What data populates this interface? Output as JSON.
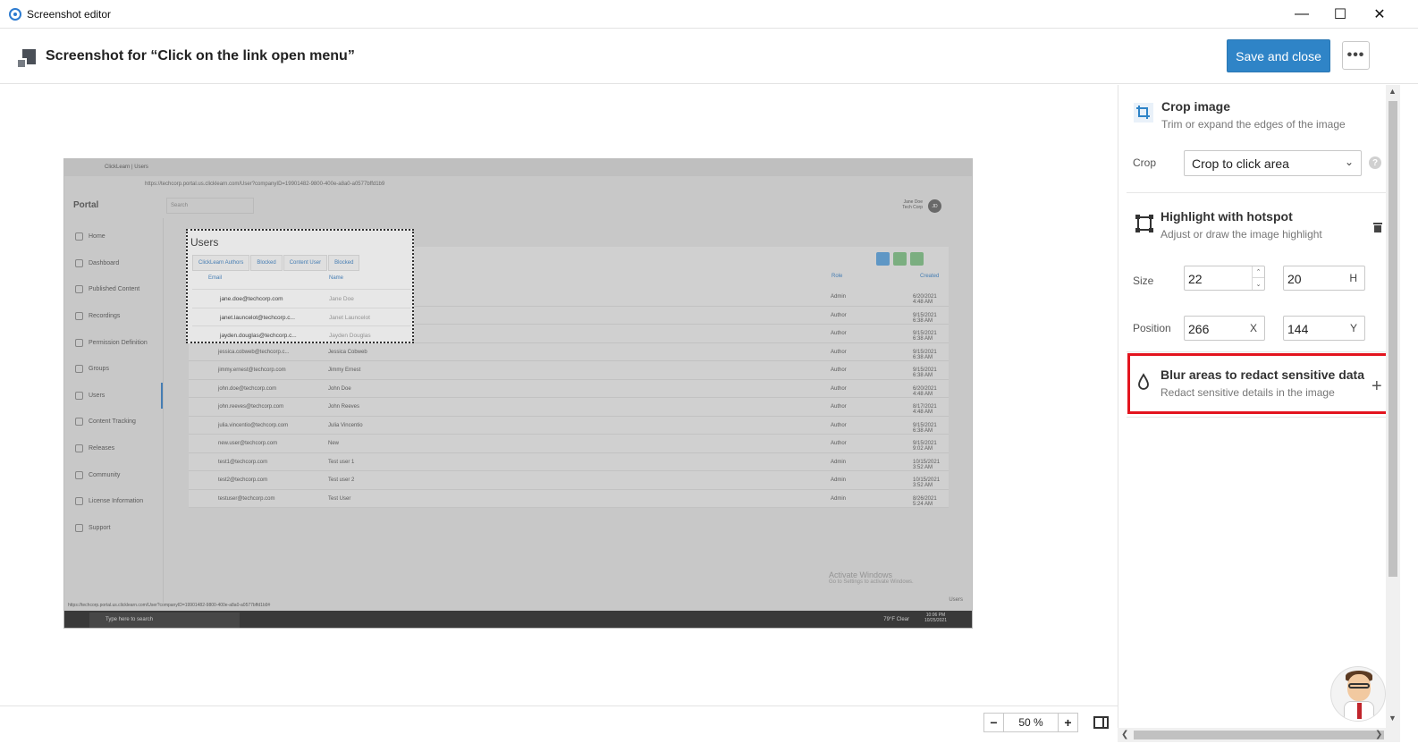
{
  "window": {
    "title": "Screenshot editor",
    "minimize": "—",
    "maximize": "☐",
    "close": "✕"
  },
  "header": {
    "title": "Screenshot for “Click on the link open menu”",
    "save_label": "Save and close",
    "more_label": "•••"
  },
  "screenshot": {
    "tab_title": "ClickLearn | Users",
    "url": "https://techcorp.portal.us.clicklearn.com/User?companyID=19901482-9800-400e-a8a0-a0577bffd1b9",
    "portal_title": "Portal",
    "search_placeholder": "Search",
    "user_name": "Jane Doe",
    "user_company": "Tech Corp",
    "avatar_initials": "JD",
    "nav": [
      "Home",
      "Dashboard",
      "Published Content",
      "Recordings",
      "Permission Definition",
      "Groups",
      "Users",
      "Content Tracking",
      "Releases",
      "Community",
      "License Information",
      "Support"
    ],
    "columns": {
      "email": "Email",
      "name": "Name",
      "role": "Role",
      "created": "Created"
    },
    "rows": [
      {
        "email": "jane.doe@techcorp.com",
        "name": "Jane Doe",
        "role": "Admin",
        "created": "6/20/2021 4:48 AM"
      },
      {
        "email": "janet.launcelot@techcorp.c...",
        "name": "Janet Launcelot",
        "role": "Author",
        "created": "9/15/2021 6:38 AM"
      },
      {
        "email": "jayden.douglas@techcorp.c...",
        "name": "Jayden Douglas",
        "role": "Author",
        "created": "9/15/2021 6:38 AM"
      },
      {
        "email": "jessica.cobweb@techcorp.c...",
        "name": "Jessica Cobweb",
        "role": "Author",
        "created": "9/15/2021 6:38 AM"
      },
      {
        "email": "jimmy.ernest@techcorp.com",
        "name": "Jimmy Ernest",
        "role": "Author",
        "created": "9/15/2021 6:38 AM"
      },
      {
        "email": "john.doe@techcorp.com",
        "name": "John Doe",
        "role": "Author",
        "created": "6/20/2021 4:48 AM"
      },
      {
        "email": "john.reeves@techcorp.com",
        "name": "John Reeves",
        "role": "Author",
        "created": "8/17/2021 4:48 AM"
      },
      {
        "email": "julia.vincentio@techcorp.com",
        "name": "Julia Vincentio",
        "role": "Author",
        "created": "9/15/2021 6:38 AM"
      },
      {
        "email": "new.user@techcorp.com",
        "name": "New",
        "role": "Author",
        "created": "9/15/2021 9:02 AM"
      },
      {
        "email": "test1@techcorp.com",
        "name": "Test user 1",
        "role": "Admin",
        "created": "10/15/2021 3:52 AM"
      },
      {
        "email": "test2@techcorp.com",
        "name": "Test user 2",
        "role": "Admin",
        "created": "10/15/2021 3:52 AM"
      },
      {
        "email": "testuser@techcorp.com",
        "name": "Test User",
        "role": "Admin",
        "created": "8/26/2021 5:24 AM"
      }
    ],
    "popup": {
      "title": "Users",
      "tabs": [
        "ClickLearn Authors",
        "Blocked",
        "Content User",
        "Blocked"
      ]
    },
    "watermark_title": "Activate Windows",
    "watermark_sub": "Go to Settings to activate Windows.",
    "status_url": "https://techcorp.portal.us.clicklearn.com/User?companyID=19901482-9800-400e-a8a0-a0577bffd1b9#",
    "users_label": "Users",
    "taskbar_search": "Type here to search",
    "weather": "79°F  Clear",
    "time": "10:06 PM",
    "date": "10/25/2021"
  },
  "panel": {
    "crop": {
      "title": "Crop image",
      "subtitle": "Trim or expand the edges of the image",
      "label": "Crop",
      "value": "Crop to click area",
      "help": "?"
    },
    "hotspot": {
      "title": "Highlight with hotspot",
      "subtitle": "Adjust or draw the image highlight",
      "size_label": "Size",
      "size_w": "22",
      "size_h": "20",
      "size_h_suffix": "H",
      "position_label": "Position",
      "pos_x": "266",
      "pos_x_suffix": "X",
      "pos_y": "144",
      "pos_y_suffix": "Y"
    },
    "blur": {
      "title": "Blur areas to redact sensitive data",
      "subtitle": "Redact sensitive details in the image",
      "add": "+"
    }
  },
  "footer": {
    "zoom_out": "−",
    "zoom_value": "50 %",
    "zoom_in": "+"
  },
  "colors": {
    "accent": "#2f84c7",
    "highlight": "#e3141e"
  }
}
